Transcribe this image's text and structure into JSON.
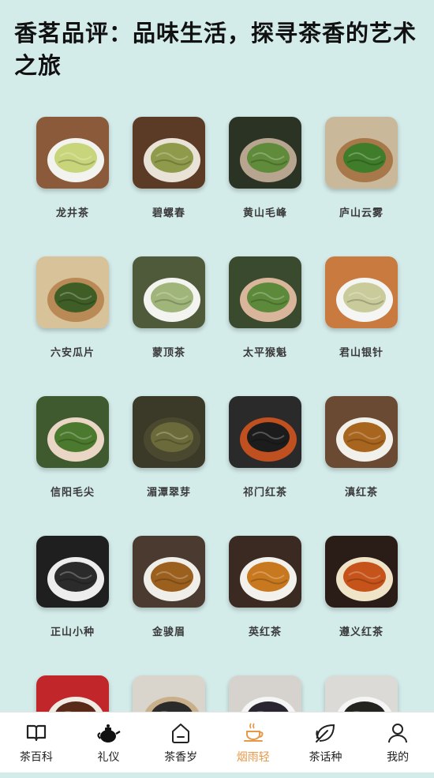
{
  "page": {
    "title": "香茗品评：品味生活，探寻茶香的艺术之旅"
  },
  "teas": [
    {
      "name": "龙井茶",
      "bg": "#8a5a3a",
      "fg": "#c9d57a",
      "bowl": "#f2f2ee"
    },
    {
      "name": "碧螺春",
      "bg": "#5b3b26",
      "fg": "#8f9a4b",
      "bowl": "#e8e3d6"
    },
    {
      "name": "黄山毛峰",
      "bg": "#2b3424",
      "fg": "#5f8b3a",
      "bowl": "#b8a58f"
    },
    {
      "name": "庐山云雾",
      "bg": "#c9b99a",
      "fg": "#3f7d2a",
      "bowl": "#a8784a"
    },
    {
      "name": "六安瓜片",
      "bg": "#d8c29a",
      "fg": "#3f5e26",
      "bowl": "#b98a55"
    },
    {
      "name": "蒙顶茶",
      "bg": "#4e5a3a",
      "fg": "#9fb57a",
      "bowl": "#f3f3f0"
    },
    {
      "name": "太平猴魁",
      "bg": "#3a4a2e",
      "fg": "#5d8a3a",
      "bowl": "#d9b59c"
    },
    {
      "name": "君山银针",
      "bg": "#c97a3e",
      "fg": "#c9cc9a",
      "bowl": "#f5f5f3"
    },
    {
      "name": "信阳毛尖",
      "bg": "#3f5a2f",
      "fg": "#4b7a2e",
      "bowl": "#e9d6c4"
    },
    {
      "name": "湄潭翠芽",
      "bg": "#3b3a28",
      "fg": "#6b6a3a",
      "bowl": "#4a4930"
    },
    {
      "name": "祁门红茶",
      "bg": "#2a2a2a",
      "fg": "#1c1c1c",
      "bowl": "#c0501f"
    },
    {
      "name": "滇红茶",
      "bg": "#6b4a34",
      "fg": "#a8651e",
      "bowl": "#f2f0ea"
    },
    {
      "name": "正山小种",
      "bg": "#1f1f1f",
      "fg": "#2b2b2b",
      "bowl": "#ededed"
    },
    {
      "name": "金骏眉",
      "bg": "#4a3a2f",
      "fg": "#9b5f1e",
      "bowl": "#f0eee8"
    },
    {
      "name": "英红茶",
      "bg": "#3a2a22",
      "fg": "#c8781e",
      "bowl": "#f3f1ec"
    },
    {
      "name": "遵义红茶",
      "bg": "#2a1c16",
      "fg": "#c6531a",
      "bowl": "#efe3c8"
    },
    {
      "name": "",
      "bg": "#c0262a",
      "fg": "#5a2a18",
      "bowl": "#f0ece4"
    },
    {
      "name": "",
      "bg": "#d9d4cc",
      "fg": "#2b2b2b",
      "bowl": "#c9b08a"
    },
    {
      "name": "",
      "bg": "#d6d3cf",
      "fg": "#2a2530",
      "bowl": "#f5f5f5"
    },
    {
      "name": "",
      "bg": "#dcdad6",
      "fg": "#23231f",
      "bowl": "#f5f5f5"
    }
  ],
  "nav": [
    {
      "label": "茶百科",
      "icon": "book-icon"
    },
    {
      "label": "礼仪",
      "icon": "teapot-icon"
    },
    {
      "label": "茶香岁",
      "icon": "home-icon"
    },
    {
      "label": "烟雨轻",
      "icon": "teacup-icon",
      "active": true
    },
    {
      "label": "茶话种",
      "icon": "leaf-icon"
    },
    {
      "label": "我的",
      "icon": "user-icon"
    }
  ],
  "colors": {
    "background": "#d3ebe9",
    "active": "#e59a4b"
  }
}
